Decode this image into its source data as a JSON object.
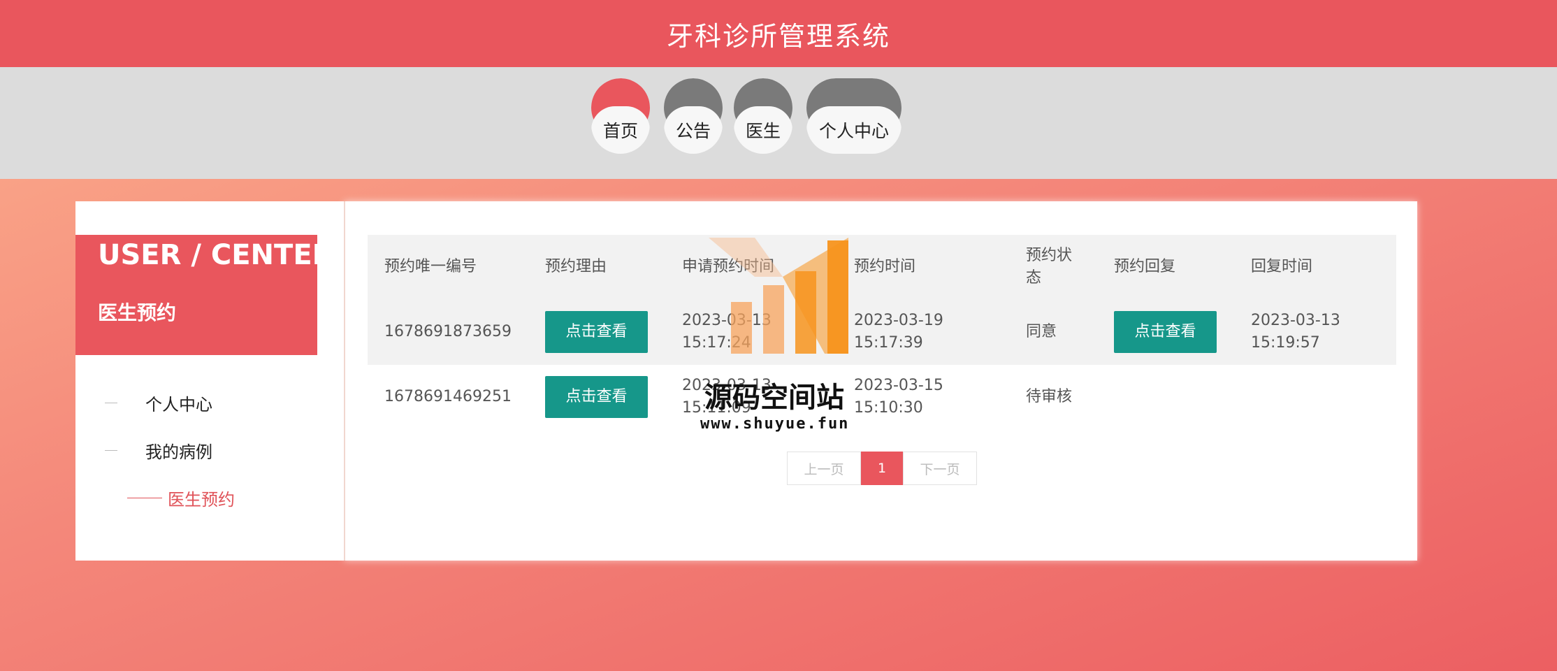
{
  "header": {
    "title": "牙科诊所管理系统"
  },
  "nav": {
    "accent_color": "#e9565d",
    "inactive_color": "#7a7a7a",
    "items": [
      {
        "label": "首页",
        "active": true
      },
      {
        "label": "公告",
        "active": false
      },
      {
        "label": "医生",
        "active": false
      },
      {
        "label": "个人中心",
        "active": false
      }
    ]
  },
  "sidebar": {
    "title_en": "USER / CENTER",
    "title_cn": "医生预约",
    "items": [
      {
        "label": "个人中心",
        "active": false
      },
      {
        "label": "我的病例",
        "active": false
      },
      {
        "label": "医生预约",
        "active": true
      }
    ]
  },
  "table": {
    "headers": [
      "预约唯一编号",
      "预约理由",
      "申请预约时间",
      "预约时间",
      "预约状态",
      "预约回复",
      "回复时间"
    ],
    "rows": [
      {
        "id": "1678691873659",
        "reason_button": "点击查看",
        "apply_time_date": "2023-03-13",
        "apply_time_clock": "15:17:24",
        "time_date": "2023-03-19",
        "time_clock": "15:17:39",
        "status": "同意",
        "reply_button": "点击查看",
        "reply_time_date": "2023-03-13",
        "reply_time_clock": "15:19:57"
      },
      {
        "id": "1678691469251",
        "reason_button": "点击查看",
        "apply_time_date": "2023-03-13",
        "apply_time_clock": "15:11:09",
        "time_date": "2023-03-15",
        "time_clock": "15:10:30",
        "status": "待审核",
        "reply_button": "",
        "reply_time_date": "",
        "reply_time_clock": ""
      }
    ]
  },
  "pagination": {
    "prev": "上一页",
    "current": "1",
    "next": "下一页"
  },
  "watermark": {
    "text": "源码空间站",
    "url": "www.shuyue.fun"
  }
}
